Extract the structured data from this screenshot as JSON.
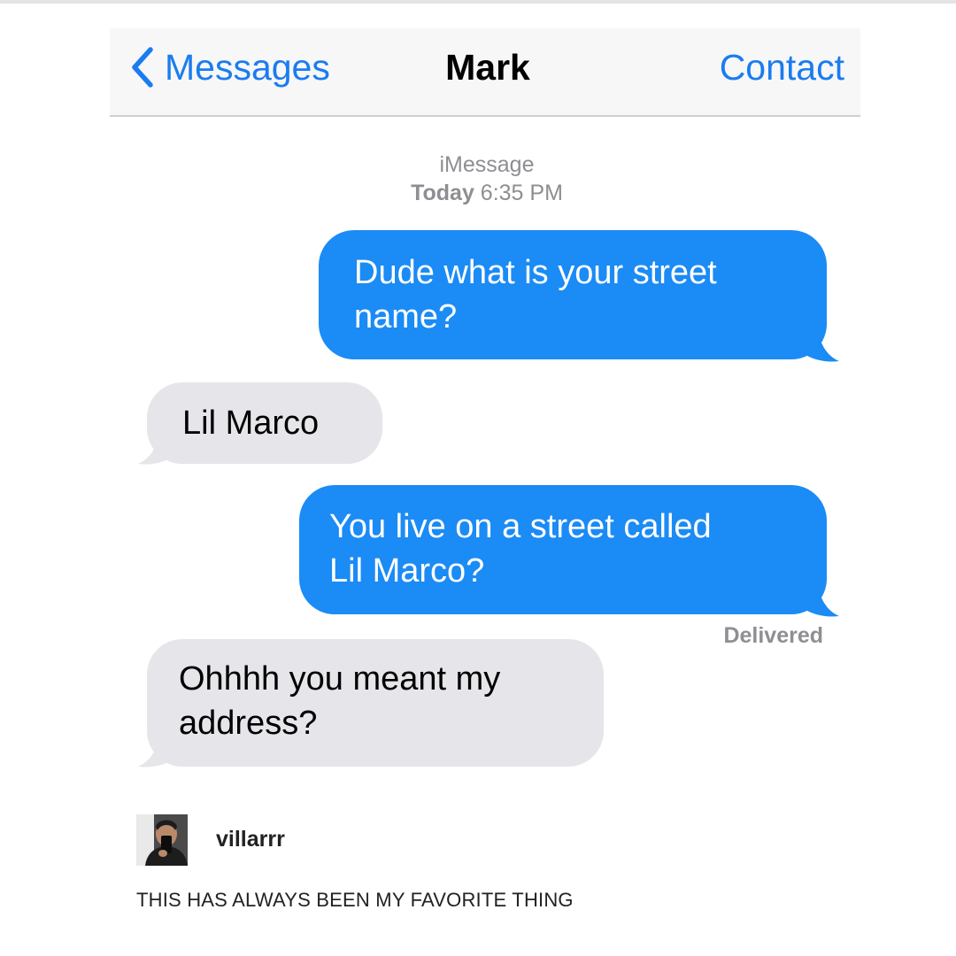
{
  "header": {
    "back_label": "Messages",
    "title": "Mark",
    "contact_label": "Contact"
  },
  "thread": {
    "service": "iMessage",
    "timestamp_day": "Today",
    "timestamp_time": "6:35 PM",
    "messages": [
      {
        "direction": "sent",
        "lines": [
          "Dude what is your street",
          "name?"
        ]
      },
      {
        "direction": "received",
        "lines": [
          "Lil Marco"
        ]
      },
      {
        "direction": "sent",
        "lines": [
          "You live on a street called",
          "Lil Marco?"
        ]
      },
      {
        "direction": "received",
        "lines": [
          "Ohhhh you meant my",
          "address?"
        ]
      }
    ],
    "delivered_label": "Delivered"
  },
  "post": {
    "username": "villarrr",
    "caption": "THIS HAS ALWAYS BEEN MY FAVORITE THING"
  },
  "colors": {
    "accent_blue": "#1a7cf0",
    "sent_bubble": "#1b8bf5",
    "received_bubble": "#e5e5ea",
    "meta_gray": "#8e8e93"
  },
  "icons": {
    "back": "chevron-left-icon"
  }
}
